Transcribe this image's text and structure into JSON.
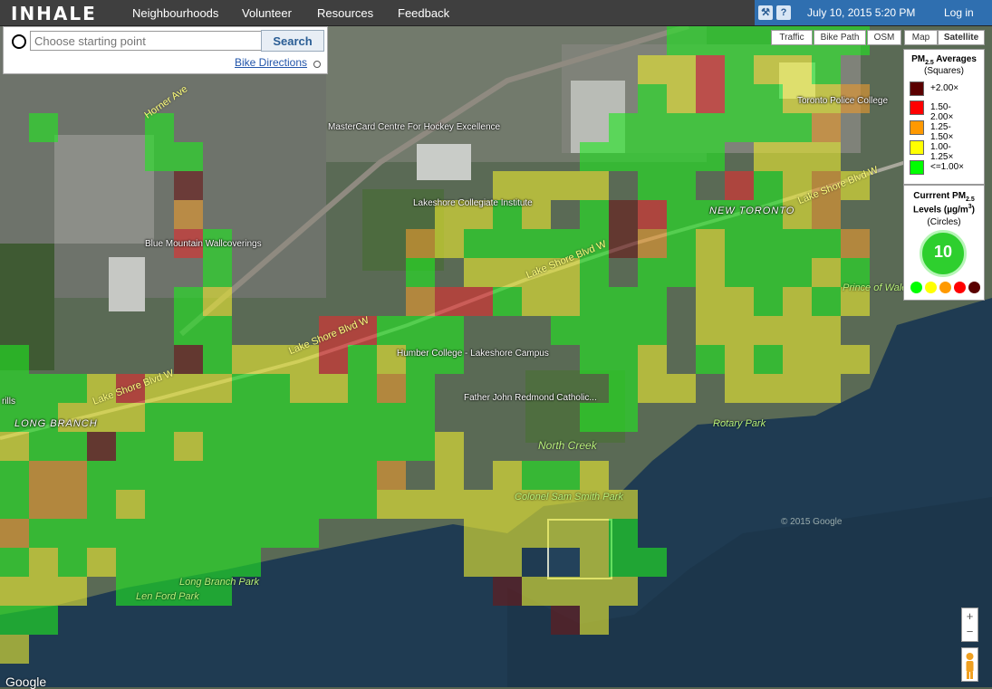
{
  "app": {
    "logo": "INHALE"
  },
  "nav": {
    "items": [
      "Neighbourhoods",
      "Volunteer",
      "Resources",
      "Feedback"
    ],
    "date": "July 10, 2015 5:20 PM",
    "login": "Log in",
    "help_label": "?"
  },
  "search": {
    "placeholder": "Choose starting point",
    "button": "Search",
    "bike_directions": "Bike Directions"
  },
  "layers": [
    "Traffic",
    "Bike Path",
    "OSM",
    "Map",
    "Satellite"
  ],
  "legend": {
    "title_prefix": "PM",
    "title_sub": "2.5",
    "title_suffix": " Averages",
    "subtitle": "(Squares)",
    "items": [
      {
        "label": "+2.00×",
        "color": "#5a0000"
      },
      {
        "label": "1.50-2.00×",
        "color": "#ff0000"
      },
      {
        "label": "1.25-1.50×",
        "color": "#ff9900"
      },
      {
        "label": "1.00-1.25×",
        "color": "#ffff00"
      },
      {
        "label": "<=1.00×",
        "color": "#00ff00"
      }
    ]
  },
  "current": {
    "title_prefix": "Currrent PM",
    "title_sub": "2.5",
    "levels_prefix": "Levels (µg/m",
    "levels_sup": "3",
    "levels_suffix": ")",
    "subtitle": "(Circles)",
    "value": "10",
    "dot_colors": [
      "#00ff00",
      "#ffff00",
      "#ff9900",
      "#ff0000",
      "#5a0000"
    ]
  },
  "map": {
    "places": {
      "horner": "Horner Ave",
      "mastercard": "MasterCard Centre For Hockey Excellence",
      "lakeshore_collegiate": "Lakeshore Collegiate Institute",
      "blue_mountain": "Blue Mountain Wallcoverings",
      "humber": "Humber College - Lakeshore Campus",
      "father_john": "Father John Redmond Catholic...",
      "toronto_police": "Toronto Police College",
      "prince_of_wales": "Prince of Wales",
      "rotary": "Rotary Park",
      "north_creek": "North Creek",
      "colonel_sam": "Colonel Sam Smith Park",
      "long_branch_park": "Long Branch Park",
      "len_ford": "Len Ford Park",
      "rills": "rills",
      "lsb_1": "Lake Shore Blvd W",
      "lsb_2": "Lake Shore Blvd W",
      "lsb_3": "Lake Shore Blvd W",
      "lsb_4": "Lake Shore Blvd W",
      "new_toronto": "NEW TORONTO",
      "long_branch": "LONG BRANCH"
    },
    "copyright": "© 2015 Google",
    "google": "Google",
    "zoom_in": "+",
    "zoom_out": "−"
  }
}
